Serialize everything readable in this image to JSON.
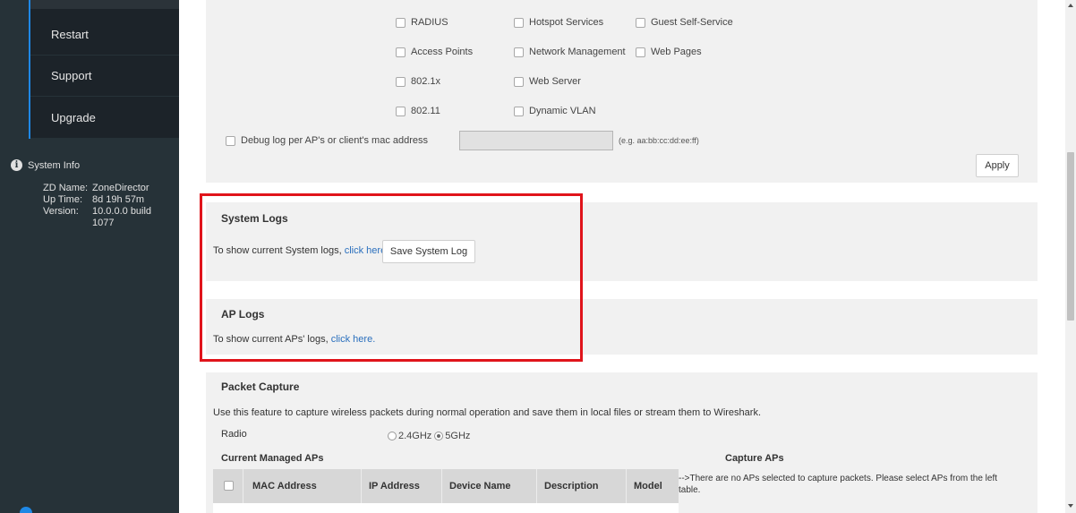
{
  "sidebar": {
    "items": [
      {
        "label": "Restart"
      },
      {
        "label": "Support"
      },
      {
        "label": "Upgrade"
      }
    ],
    "system_info": {
      "title": "System Info",
      "rows": [
        {
          "key": "ZD Name:",
          "value": "ZoneDirector"
        },
        {
          "key": "Up Time:",
          "value": "8d 19h 57m"
        },
        {
          "key": "Version:",
          "value": "10.0.0.0 build 1077"
        }
      ]
    }
  },
  "debug": {
    "options": [
      {
        "label": "RADIUS"
      },
      {
        "label": "Hotspot Services"
      },
      {
        "label": "Guest Self-Service"
      },
      {
        "label": "Access Points"
      },
      {
        "label": "Network Management"
      },
      {
        "label": "Web Pages"
      },
      {
        "label": "802.1x"
      },
      {
        "label": "Web Server"
      },
      {
        "label": "802.11"
      },
      {
        "label": "Dynamic VLAN"
      }
    ],
    "mac_label": "Debug log per AP's or client's mac address",
    "mac_value": "",
    "mac_hint": "(e.g. aa:bb:cc:dd:ee:ff)",
    "apply_label": "Apply"
  },
  "system_logs": {
    "title": "System Logs",
    "text": "To show current System logs,",
    "link": "click here.",
    "button": "Save System Log"
  },
  "ap_logs": {
    "title": "AP Logs",
    "text": "To show current APs' logs,",
    "link": "click here."
  },
  "packet_capture": {
    "title": "Packet Capture",
    "description": "Use this feature to capture wireless packets during normal operation and save them in local files or stream them to Wireshark.",
    "radio_label": "Radio",
    "radio_options": [
      {
        "label": "2.4GHz",
        "checked": false
      },
      {
        "label": "5GHz",
        "checked": true
      }
    ],
    "managed_title": "Current Managed APs",
    "capture_title": "Capture APs",
    "columns": [
      "MAC Address",
      "IP Address",
      "Device Name",
      "Description",
      "Model"
    ],
    "capture_message": "-->There are no APs selected to capture packets. Please select APs from the left table."
  }
}
